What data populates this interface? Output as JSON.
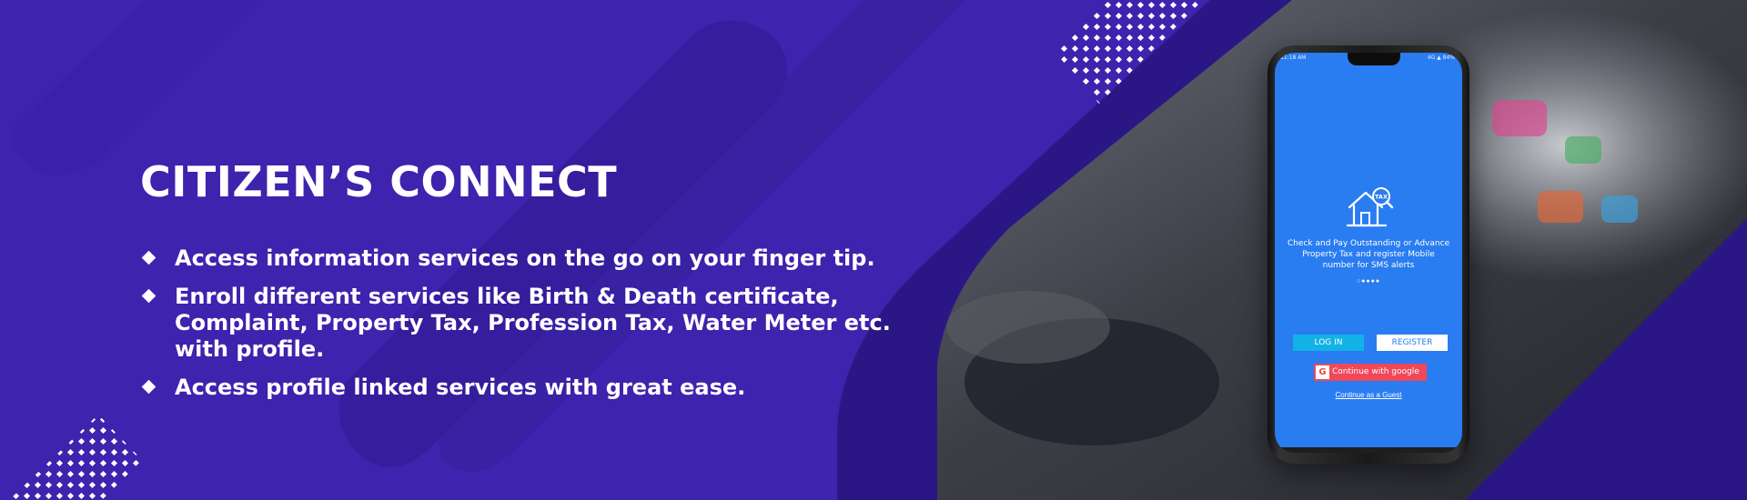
{
  "hero": {
    "title": "CITIZEN’S CONNECT",
    "features": [
      {
        "text": "Access information services on the go on your finger tip."
      },
      {
        "text": "Enroll different services like Birth & Death certificate, Complaint, Property Tax, Profession Tax, Water Meter etc. with profile."
      },
      {
        "text": "Access profile linked services with great ease."
      }
    ]
  },
  "phone": {
    "status_time": "11:18 AM",
    "status_right": "4G ▲ 84%",
    "icon_badge": "TAX",
    "tagline": "Check and Pay Outstanding or Advance Property Tax and register Mobile number for SMS alerts",
    "loading_dots": "○●●●●",
    "login_label": "LOG IN",
    "register_label": "REGISTER",
    "google_icon_letter": "G",
    "google_label": "Continue with google",
    "guest_label": "Continue as a Guest"
  },
  "colors": {
    "background": "#3d23ad",
    "dark_band": "#2a1785",
    "app_blue": "#2a7cf1",
    "login_button": "#12b2e6",
    "google_button": "#f0485a"
  },
  "icons": [
    "diamond-bullet-icon",
    "house-tax-icon",
    "google-icon",
    "dot-pattern"
  ]
}
